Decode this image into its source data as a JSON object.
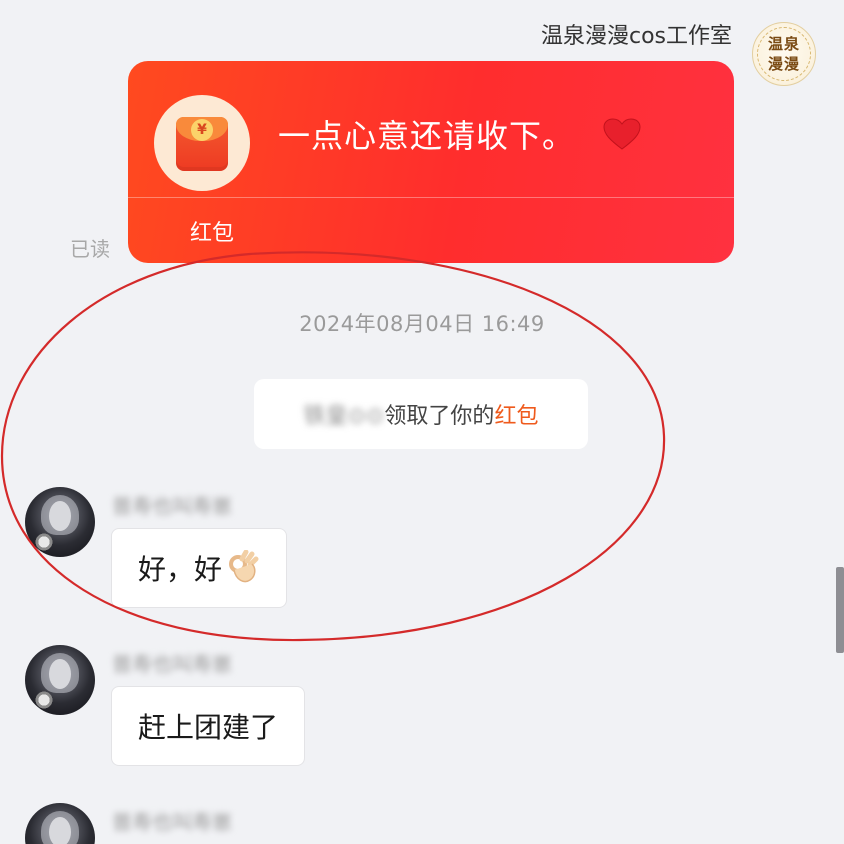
{
  "outgoing": {
    "sender_name": "温泉漫漫cos工作室",
    "avatar_text": "温泉漫漫",
    "red_packet": {
      "coin_glyph": "¥",
      "message": "一点心意还请收下。",
      "type_label": "红包",
      "heart_icon": "heart-icon",
      "colors": {
        "start": "#ff4a1f",
        "end": "#ff3140",
        "icon_bg": "#fde9d4"
      }
    },
    "read_status": "已读"
  },
  "timestamp": "2024年08月04日 16:49",
  "system_notice": {
    "blurred_name": "铁皇⊙⊙",
    "text": "领取了你的",
    "link": "红包",
    "link_color": "#ef5a1c"
  },
  "incoming": [
    {
      "nickname": "普寿也叫寿崽",
      "text": "好，好",
      "emoji": "ok-hand-icon"
    },
    {
      "nickname": "普寿也叫寿崽",
      "text": "赶上团建了",
      "emoji": ""
    },
    {
      "nickname": "普寿也叫寿崽",
      "text": "",
      "emoji": ""
    }
  ],
  "annotation_color": "#d42a2a"
}
